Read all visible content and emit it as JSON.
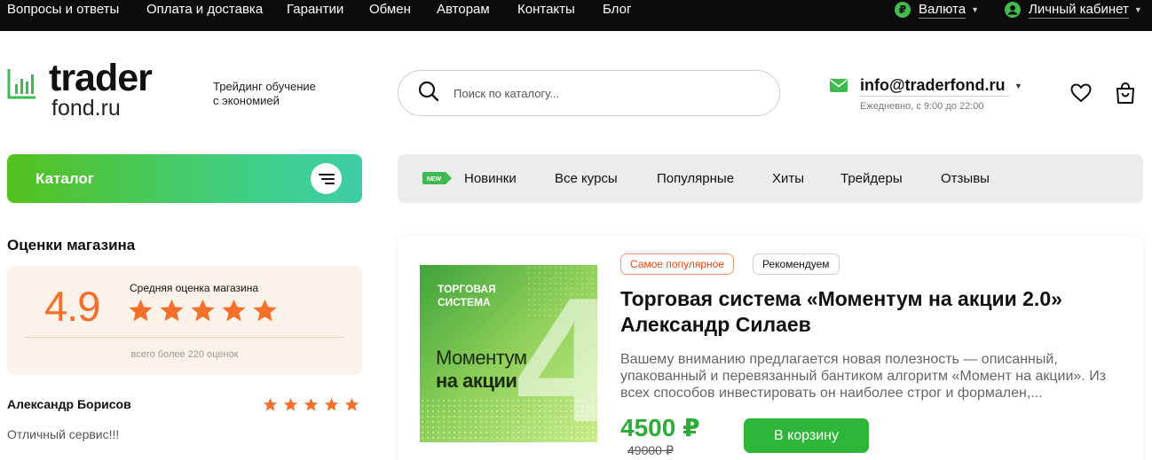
{
  "topbar": {
    "links": [
      "Вопросы и ответы",
      "Оплата и доставка",
      "Гарантии",
      "Обмен",
      "Авторам",
      "Контакты",
      "Блог"
    ],
    "currency_label": "Валюта",
    "currency_symbol": "₽",
    "account_label": "Личный кабинет"
  },
  "header": {
    "logo_main": "trader",
    "logo_sub": "fond.ru",
    "tagline_line1": "Трейдинг обучение",
    "tagline_line2": "с экономией",
    "search_placeholder": "Поиск по каталогу...",
    "email": "info@traderfond.ru",
    "hours": "Ежедневно, с 9:00 до 22:00"
  },
  "catalog": {
    "label": "Каталог"
  },
  "nav": {
    "new_badge": "NEW",
    "items": [
      "Новинки",
      "Все курсы",
      "Популярные",
      "Хиты",
      "Трейдеры",
      "Отзывы"
    ]
  },
  "ratings": {
    "title": "Оценки магазина",
    "score": "4.9",
    "avg_label": "Средняя оценка магазина",
    "stars": 5,
    "reviews_count": "всего более 220 оценок",
    "review": {
      "author": "Александр Борисов",
      "stars": 5,
      "text": "Отличный сервис!!!"
    }
  },
  "product": {
    "cover_top_line1": "ТОРГОВАЯ",
    "cover_top_line2": "СИСТЕМА",
    "cover_title_line1": "Моментум",
    "cover_title_line2": "на акции",
    "cover_number": "4",
    "badge_popular": "Самое популярное",
    "badge_recommended": "Рекомендуем",
    "title": "Торговая система «Моментум на акции 2.0» Александр Силаев",
    "description": "Вашему вниманию предлагается новая полезность — описанный, упакованный и перевязанный бантиком алгоритм «Момент на акции». Из всех способов инвестировать он наиболее строг и формален,...",
    "price": "4500 ₽",
    "old_price": "49000 ₽",
    "cart_button": "В корзину"
  },
  "colors": {
    "accent_green": "#2fb53a",
    "orange": "#f36f2a",
    "topbar_bg": "#0c0c0c"
  }
}
